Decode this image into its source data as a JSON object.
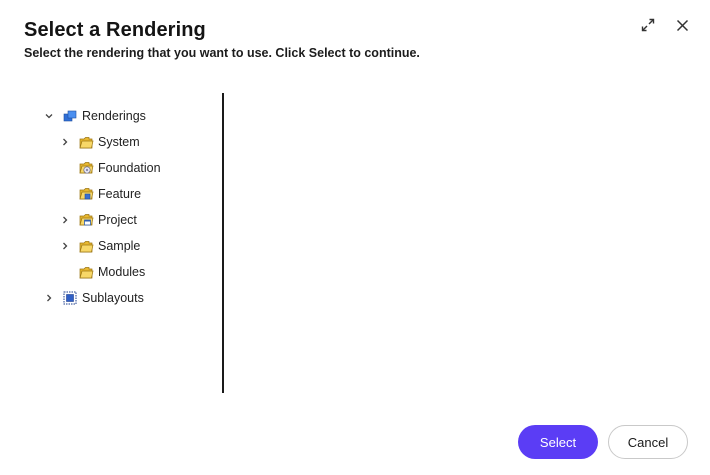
{
  "dialog": {
    "title": "Select a Rendering",
    "subtitle": "Select the rendering that you want to use. Click Select to continue."
  },
  "header_icons": {
    "expand": "expand-icon",
    "close": "close-icon"
  },
  "tree": {
    "root": {
      "label": "Renderings",
      "expanded": true,
      "icon": "renderings-icon"
    },
    "children": [
      {
        "label": "System",
        "expandable": true,
        "icon": "folder-icon"
      },
      {
        "label": "Foundation",
        "expandable": false,
        "icon": "foundation-folder-icon"
      },
      {
        "label": "Feature",
        "expandable": false,
        "icon": "feature-folder-icon"
      },
      {
        "label": "Project",
        "expandable": true,
        "icon": "project-folder-icon"
      },
      {
        "label": "Sample",
        "expandable": true,
        "icon": "folder-icon"
      },
      {
        "label": "Modules",
        "expandable": false,
        "icon": "folder-icon"
      }
    ],
    "sibling": {
      "label": "Sublayouts",
      "expandable": true,
      "icon": "sublayouts-icon"
    }
  },
  "footer": {
    "select_label": "Select",
    "cancel_label": "Cancel"
  },
  "colors": {
    "primary": "#5b3df5",
    "folder": "#f2c94c",
    "text": "#1a1a1a"
  }
}
